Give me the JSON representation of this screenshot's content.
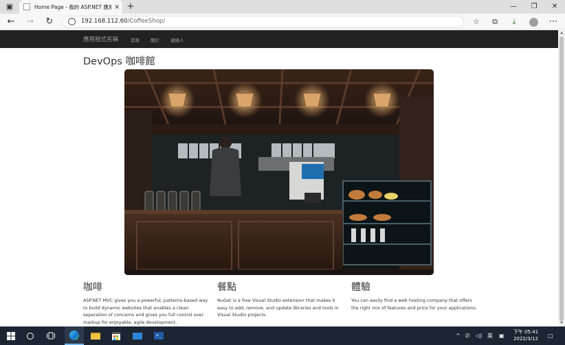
{
  "browser": {
    "tab_title": "Home Page - 我的 ASP.NET 應用",
    "url_host": "192.168.112.60",
    "url_path": "/CoffeeShop/",
    "tab_close": "×",
    "new_tab": "+"
  },
  "nav": {
    "brand": "應用程式名稱",
    "links": [
      "首頁",
      "關於",
      "連絡人"
    ]
  },
  "page": {
    "heading": "DevOps 咖啡館",
    "columns": [
      {
        "title": "咖啡",
        "text": "ASP.NET MVC gives you a powerful, patterns-based way to build dynamic websites that enables a clean separation of concerns and gives you full control over markup for enjoyable, agile development."
      },
      {
        "title": "餐點",
        "text": "NuGet is a free Visual Studio extension that makes it easy to add, remove, and update libraries and tools in Visual Studio projects."
      },
      {
        "title": "體驗",
        "text": "You can easily find a web hosting company that offers the right mix of features and price for your applications."
      }
    ]
  },
  "taskbar": {
    "ime": "英",
    "time": "下午 05:41",
    "date": "2022/3/12"
  },
  "colors": {
    "nav_bg": "#222222",
    "taskbar_bg": "#1c2532",
    "text": "#333333"
  }
}
